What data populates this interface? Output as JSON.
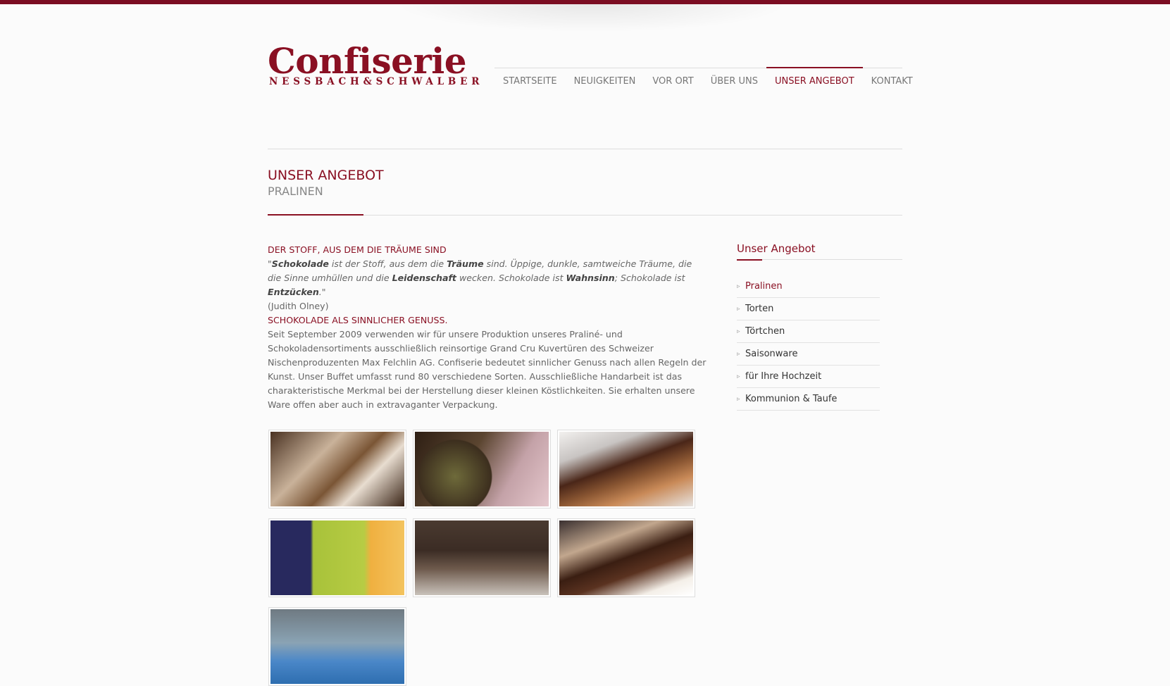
{
  "colors": {
    "accent": "#8a1023",
    "topbar": "#7b0d22",
    "text": "#666666"
  },
  "logo": {
    "title": "Confiserie",
    "subtitle": "NESSBACH&SCHWALBER"
  },
  "nav": {
    "items": [
      {
        "label": "STARTSEITE"
      },
      {
        "label": "NEUIGKEITEN"
      },
      {
        "label": "VOR ORT"
      },
      {
        "label": "ÜBER UNS"
      },
      {
        "label": "UNSER ANGEBOT",
        "active": true
      },
      {
        "label": "KONTAKT"
      }
    ]
  },
  "page": {
    "title": "UNSER ANGEBOT",
    "subtitle": "PRALINEN"
  },
  "content": {
    "heading1": "DER STOFF, AUS DEM DIE TRÄUME SIND",
    "quote": {
      "q_open": "\"",
      "w1": "Schokolade",
      "t1": " ist der Stoff, aus dem die ",
      "w2": "Träume",
      "t2": " sind. Üppige, dunkle, samtweiche Träume, die die Sinne umhüllen und die ",
      "w3": "Leidenschaft",
      "t3": " wecken. Schokolade ist ",
      "w4": "Wahnsinn",
      "t4": "; Schokolade ist ",
      "w5": "Entzücken",
      "q_close": ".\""
    },
    "author": "(Judith Olney)",
    "heading2": "SCHOKOLADE ALS SINNLICHER GENUSS.",
    "body": "Seit September 2009 verwenden wir für unsere Produktion unseres Praliné- und Schokoladensortiments ausschließlich reinsortige Grand Cru Kuvertüren des Schweizer Nischenproduzenten Max Felchlin AG. Confiserie bedeutet sinnlicher Genuss nach allen Regeln der Kunst. Unser Buffet umfasst rund 80 verschiedene Sorten. Ausschließliche Handarbeit ist das charakteristische Merkmal bei der Herstellung dieser kleinen Köstlichkeiten. Sie erhalten unsere Ware offen aber auch in extravaganter Verpackung."
  },
  "sidebar": {
    "title": "Unser Angebot",
    "items": [
      {
        "label": "Pralinen",
        "active": true
      },
      {
        "label": "Torten"
      },
      {
        "label": "Törtchen"
      },
      {
        "label": "Saisonware"
      },
      {
        "label": "für Ihre Hochzeit"
      },
      {
        "label": "Kommunion & Taufe"
      }
    ]
  }
}
